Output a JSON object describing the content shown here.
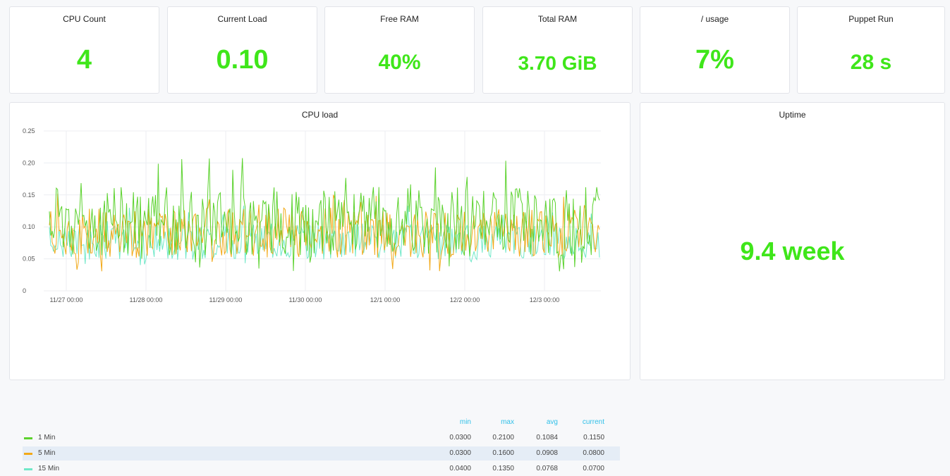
{
  "stats": [
    {
      "title": "CPU Count",
      "value": "4"
    },
    {
      "title": "Current Load",
      "value": "0.10"
    },
    {
      "title": "Free RAM",
      "value": "40%"
    },
    {
      "title": "Total RAM",
      "value": "3.70 GiB"
    },
    {
      "title": "/ usage",
      "value": "7%"
    },
    {
      "title": "Puppet Run",
      "value": "28 s"
    }
  ],
  "uptime": {
    "title": "Uptime",
    "value": "9.4 week"
  },
  "colors": {
    "accent": "#3fe61a",
    "series1": "#5bd22d",
    "series2": "#f2a918",
    "series3": "#6fe8c8",
    "legend_header": "#31c0e8"
  },
  "chart_data": {
    "type": "line",
    "title": "CPU load",
    "xlabel": "",
    "ylabel": "",
    "ylim": [
      0,
      0.25
    ],
    "y_ticks": [
      "0.25",
      "0.20",
      "0.15",
      "0.10",
      "0.05",
      "0"
    ],
    "x_ticks": [
      "11/27 00:00",
      "11/28 00:00",
      "11/29 00:00",
      "11/30 00:00",
      "12/1 00:00",
      "12/2 00:00",
      "12/3 00:00"
    ],
    "grid": true,
    "legend_columns": [
      "min",
      "max",
      "avg",
      "current"
    ],
    "series": [
      {
        "name": "1 Min",
        "color": "#5bd22d",
        "min": "0.0300",
        "max": "0.2100",
        "avg": "0.1084",
        "current": "0.1150"
      },
      {
        "name": "5 Min",
        "color": "#f2a918",
        "min": "0.0300",
        "max": "0.1600",
        "avg": "0.0908",
        "current": "0.0800"
      },
      {
        "name": "15 Min",
        "color": "#6fe8c8",
        "min": "0.0400",
        "max": "0.1350",
        "avg": "0.0768",
        "current": "0.0700"
      }
    ]
  }
}
